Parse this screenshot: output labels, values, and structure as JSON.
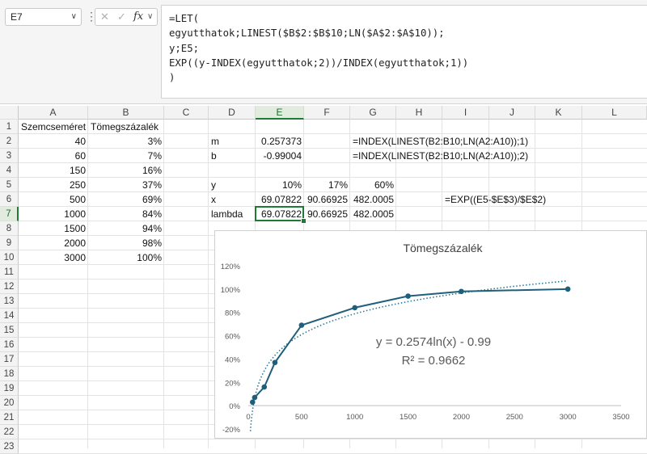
{
  "toolbar": {
    "name_box": "E7",
    "name_box_caret": "∨",
    "kebab": "⋮",
    "cancel_glyph": "✕",
    "enter_glyph": "✓",
    "fx_label": "fx",
    "fx_caret": "∨"
  },
  "formula_lines": [
    "=LET(",
    "egyutthatok;LINEST($B$2:$B$10;LN($A$2:$A$10));",
    "y;E5;",
    "EXP((y-INDEX(egyutthatok;2))/INDEX(egyutthatok;1))",
    ")"
  ],
  "columns": [
    "A",
    "B",
    "C",
    "D",
    "E",
    "F",
    "G",
    "H",
    "I",
    "J",
    "K",
    "L"
  ],
  "rows": [
    "1",
    "2",
    "3",
    "4",
    "5",
    "6",
    "7",
    "8",
    "9",
    "10",
    "11",
    "12",
    "13",
    "14",
    "15",
    "16",
    "17",
    "18",
    "19",
    "20",
    "21",
    "22",
    "23"
  ],
  "selected": {
    "col": "E",
    "row": "7"
  },
  "cells": [
    {
      "col": "A",
      "row": 1,
      "v": "Szemcseméret",
      "align": "l"
    },
    {
      "col": "B",
      "row": 1,
      "v": "Tömegszázalék",
      "align": "l"
    },
    {
      "col": "A",
      "row": 2,
      "v": "40",
      "align": "r"
    },
    {
      "col": "B",
      "row": 2,
      "v": "3%",
      "align": "r"
    },
    {
      "col": "A",
      "row": 3,
      "v": "60",
      "align": "r"
    },
    {
      "col": "B",
      "row": 3,
      "v": "7%",
      "align": "r"
    },
    {
      "col": "A",
      "row": 4,
      "v": "150",
      "align": "r"
    },
    {
      "col": "B",
      "row": 4,
      "v": "16%",
      "align": "r"
    },
    {
      "col": "A",
      "row": 5,
      "v": "250",
      "align": "r"
    },
    {
      "col": "B",
      "row": 5,
      "v": "37%",
      "align": "r"
    },
    {
      "col": "A",
      "row": 6,
      "v": "500",
      "align": "r"
    },
    {
      "col": "B",
      "row": 6,
      "v": "69%",
      "align": "r"
    },
    {
      "col": "A",
      "row": 7,
      "v": "1000",
      "align": "r"
    },
    {
      "col": "B",
      "row": 7,
      "v": "84%",
      "align": "r"
    },
    {
      "col": "A",
      "row": 8,
      "v": "1500",
      "align": "r"
    },
    {
      "col": "B",
      "row": 8,
      "v": "94%",
      "align": "r"
    },
    {
      "col": "A",
      "row": 9,
      "v": "2000",
      "align": "r"
    },
    {
      "col": "B",
      "row": 9,
      "v": "98%",
      "align": "r"
    },
    {
      "col": "A",
      "row": 10,
      "v": "3000",
      "align": "r"
    },
    {
      "col": "B",
      "row": 10,
      "v": "100%",
      "align": "r"
    },
    {
      "col": "D",
      "row": 2,
      "v": "m",
      "align": "l"
    },
    {
      "col": "E",
      "row": 2,
      "v": "0.257373",
      "align": "r"
    },
    {
      "col": "G",
      "row": 2,
      "v": "=INDEX(LINEST(B2:B10;LN(A2:A10));1)",
      "align": "l"
    },
    {
      "col": "D",
      "row": 3,
      "v": "b",
      "align": "l"
    },
    {
      "col": "E",
      "row": 3,
      "v": "-0.99004",
      "align": "r"
    },
    {
      "col": "G",
      "row": 3,
      "v": "=INDEX(LINEST(B2:B10;LN(A2:A10));2)",
      "align": "l"
    },
    {
      "col": "D",
      "row": 5,
      "v": "y",
      "align": "l"
    },
    {
      "col": "E",
      "row": 5,
      "v": "10%",
      "align": "r"
    },
    {
      "col": "F",
      "row": 5,
      "v": "17%",
      "align": "r"
    },
    {
      "col": "G",
      "row": 5,
      "v": "60%",
      "align": "r"
    },
    {
      "col": "D",
      "row": 6,
      "v": "x",
      "align": "l"
    },
    {
      "col": "E",
      "row": 6,
      "v": "69.07822",
      "align": "r"
    },
    {
      "col": "F",
      "row": 6,
      "v": "90.66925",
      "align": "r"
    },
    {
      "col": "G",
      "row": 6,
      "v": "482.0005",
      "align": "r"
    },
    {
      "col": "I",
      "row": 6,
      "v": "=EXP((E5-$E$3)/$E$2)",
      "align": "l"
    },
    {
      "col": "D",
      "row": 7,
      "v": "lambda",
      "align": "l"
    },
    {
      "col": "E",
      "row": 7,
      "v": "69.07822",
      "align": "r"
    },
    {
      "col": "F",
      "row": 7,
      "v": "90.66925",
      "align": "r"
    },
    {
      "col": "G",
      "row": 7,
      "v": "482.0005",
      "align": "r"
    }
  ],
  "chart_data": {
    "type": "scatter",
    "title": "Tömegszázalék",
    "series": [
      {
        "x": [
          40,
          60,
          150,
          250,
          500,
          1000,
          1500,
          2000,
          3000
        ],
        "y": [
          0.03,
          0.07,
          0.16,
          0.37,
          0.69,
          0.84,
          0.94,
          0.98,
          1.0
        ]
      }
    ],
    "trendline": {
      "kind": "logarithmic",
      "m": 0.2574,
      "b": -0.99,
      "style": "dotted"
    },
    "equation": "y = 0.2574ln(x) - 0.99",
    "r_squared": "R² = 0.9662",
    "xlim": [
      0,
      3500
    ],
    "ylim": [
      -0.2,
      1.2
    ],
    "x_ticks": [
      0,
      500,
      1000,
      1500,
      2000,
      2500,
      3000,
      3500
    ],
    "y_ticks": [
      "-20%",
      "0%",
      "20%",
      "40%",
      "60%",
      "80%",
      "100%",
      "120%"
    ],
    "y_tick_values": [
      -0.2,
      0,
      0.2,
      0.4,
      0.6,
      0.8,
      1.0,
      1.2
    ],
    "grid": false,
    "series_color": "#1f5f7a",
    "trend_color": "#2a7a9a"
  }
}
